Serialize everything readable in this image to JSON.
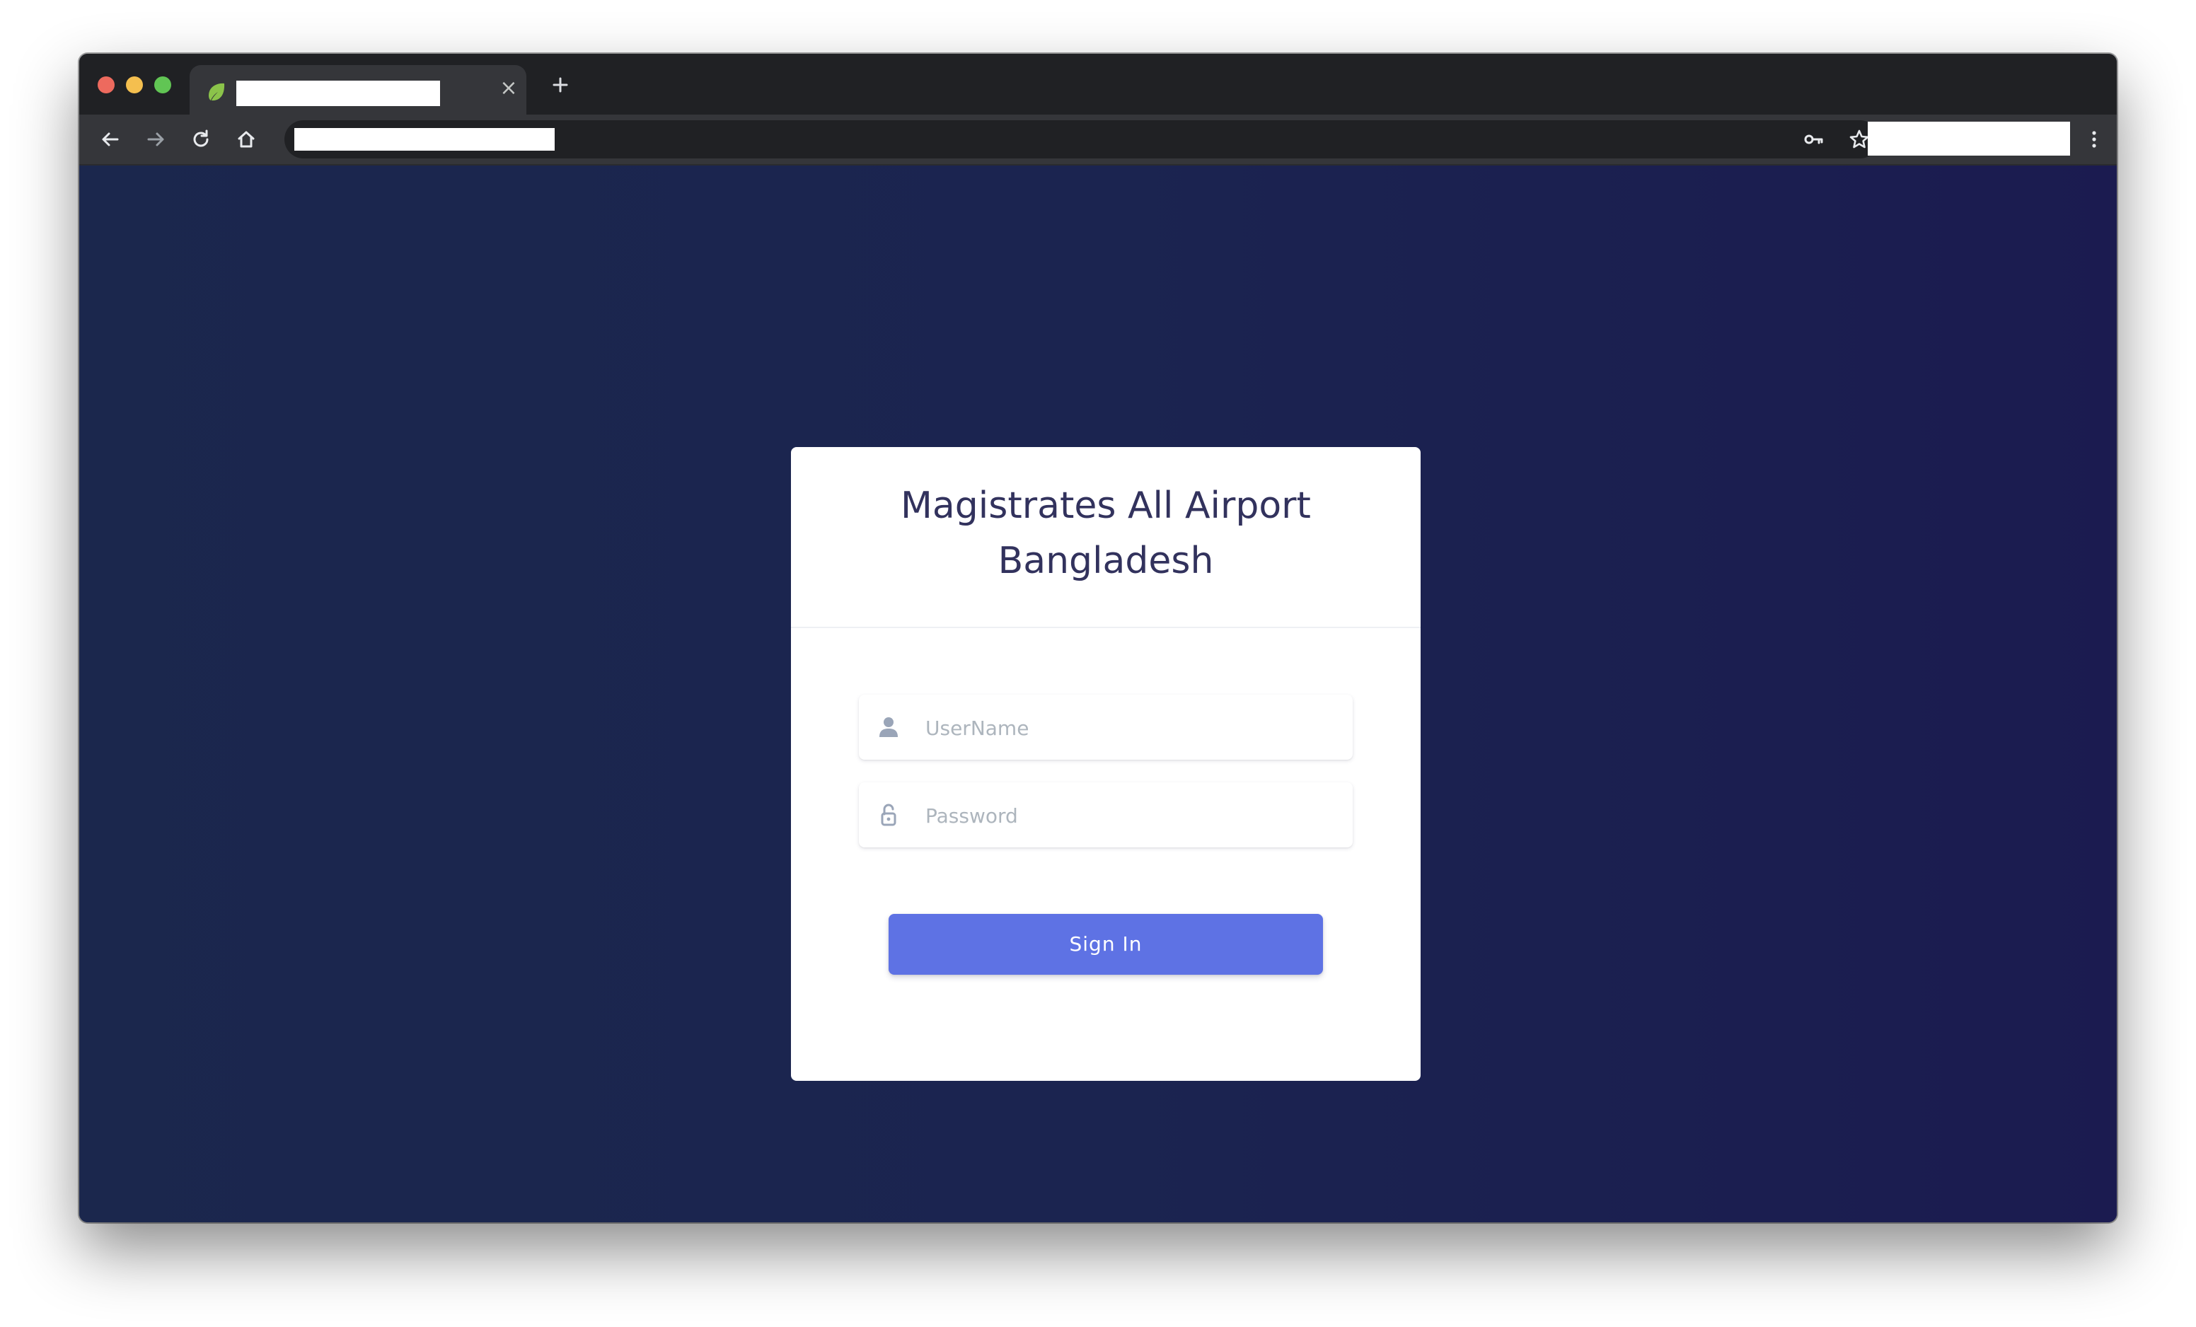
{
  "browser": {
    "tab": {
      "close_glyph": "×"
    },
    "icons": {
      "favicon": "spring-leaf-icon",
      "new_tab": "plus-icon",
      "back": "arrow-left-icon",
      "forward": "arrow-right-icon",
      "reload": "reload-icon",
      "home": "home-icon",
      "password": "key-icon",
      "bookmark": "star-icon",
      "menu": "kebab-menu-icon"
    }
  },
  "login": {
    "title": "Magistrates All Airport Bangladesh",
    "username_placeholder": "UserName",
    "password_placeholder": "Password",
    "sign_in_label": "Sign In"
  },
  "colors": {
    "background_start": "#1b274d",
    "background_end": "#1b1b50",
    "title": "#32325d",
    "primary_button": "#5e72e4",
    "favicon_leaf": "#8bc34a"
  }
}
